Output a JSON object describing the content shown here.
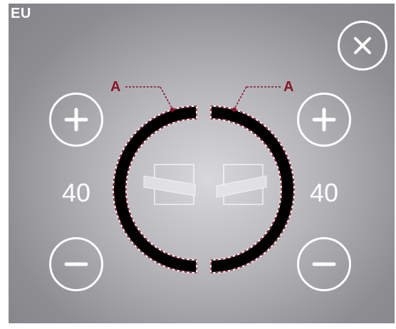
{
  "region": {
    "label": "EU"
  },
  "left_control": {
    "value": "40",
    "increase_icon": "plus-icon",
    "decrease_icon": "minus-icon"
  },
  "right_control": {
    "value": "40",
    "increase_icon": "plus-icon",
    "decrease_icon": "minus-icon"
  },
  "close_button": {
    "icon": "close-icon"
  },
  "callouts": {
    "left": "A",
    "right": "A"
  },
  "colors": {
    "callout": "#8a1428",
    "ring": "#000000",
    "foreground": "#ffffff"
  }
}
